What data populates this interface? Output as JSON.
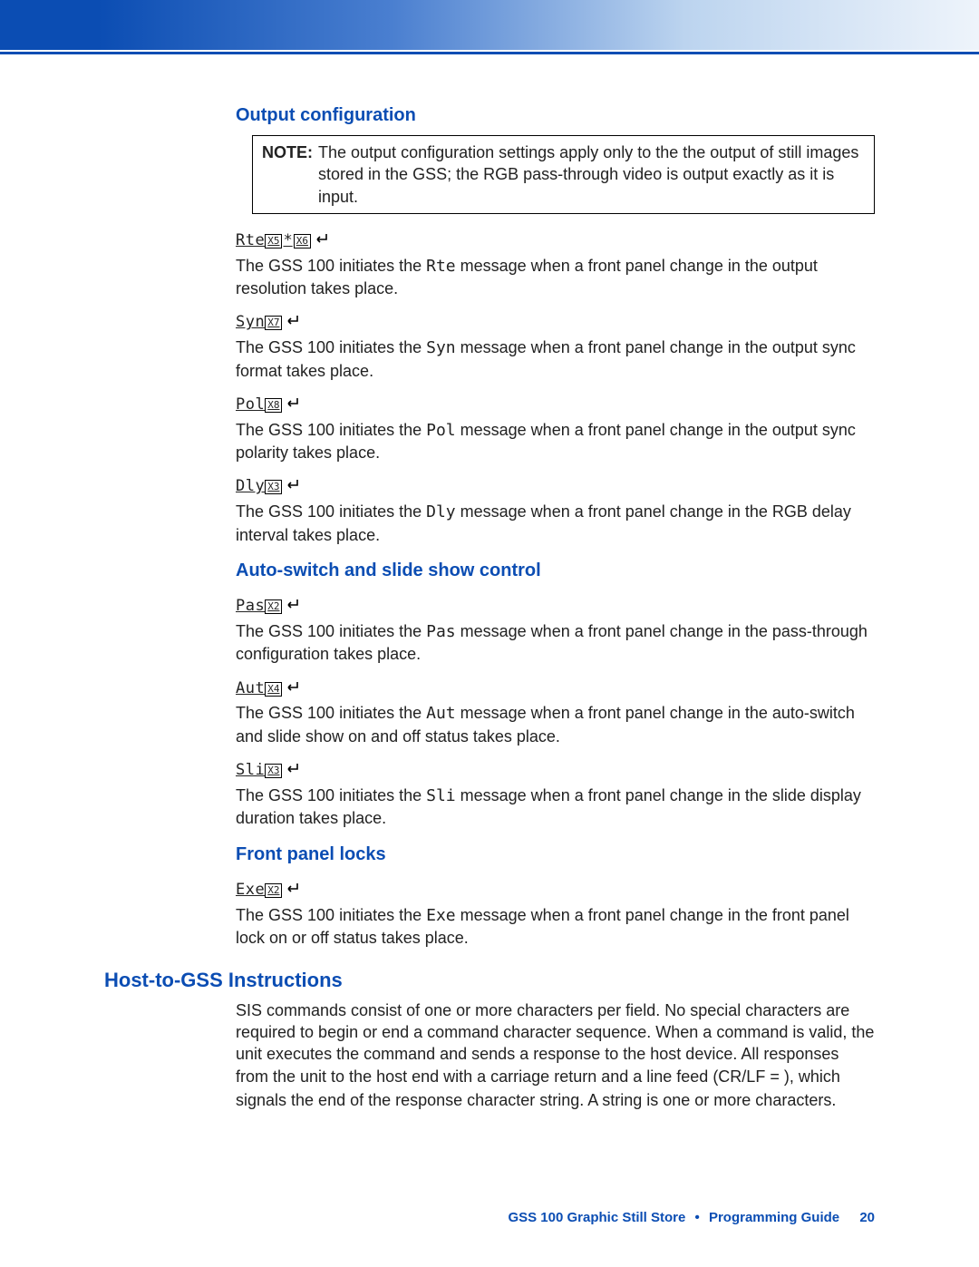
{
  "sections": {
    "output_config": {
      "heading": "Output configuration",
      "note_label": "NOTE:",
      "note_body": "The output configuration settings apply only to the the output of still images stored in the GSS; the RGB pass-through video is output exactly as it is input.",
      "items": [
        {
          "cmd": "Rte",
          "params": [
            "X5",
            "X6"
          ],
          "joiner": "*",
          "part1": "The GSS 100 initiates the ",
          "code": "Rte",
          "part2": " message when a front panel change in the output resolution takes place."
        },
        {
          "cmd": "Syn",
          "params": [
            "X7"
          ],
          "part1": "The GSS 100 initiates the ",
          "code": "Syn",
          "part2": " message when a front panel change in the output sync format takes place."
        },
        {
          "cmd": "Pol",
          "params": [
            "X8"
          ],
          "part1": "The GSS 100 initiates the ",
          "code": "Pol",
          "part2": " message when a front panel change in the output sync polarity takes place."
        },
        {
          "cmd": "Dly",
          "params": [
            "X3"
          ],
          "part1": "The GSS 100 initiates the ",
          "code": "Dly",
          "part2": " message when a front panel change in the RGB delay interval takes place."
        }
      ]
    },
    "auto_switch": {
      "heading": "Auto-switch and slide show control",
      "items": [
        {
          "cmd": "Pas",
          "params": [
            "X2"
          ],
          "part1": "The GSS 100 initiates the ",
          "code": "Pas",
          "part2": " message when a front panel change in the pass-through configuration takes place."
        },
        {
          "cmd": "Aut",
          "params": [
            "X4"
          ],
          "part1": "The GSS 100 initiates the ",
          "code": "Aut",
          "part2": " message when a front panel change in the auto-switch and slide show on and off status takes place."
        },
        {
          "cmd": "Sli",
          "params": [
            "X3"
          ],
          "part1": "The GSS 100 initiates the ",
          "code": "Sli",
          "part2": " message when a front panel change in the slide display duration takes place."
        }
      ]
    },
    "front_panel": {
      "heading": "Front panel locks",
      "items": [
        {
          "cmd": "Exe",
          "params": [
            "X2"
          ],
          "part1": "The GSS 100 initiates the ",
          "code": "Exe",
          "part2": " message when a front panel change in the front panel lock on or off status takes place."
        }
      ]
    },
    "host_to_gss": {
      "heading": "Host-to-GSS Instructions",
      "para_a": "SIS commands consist of one or more characters per field. No special characters are required to begin or end a command character sequence. When a command is valid, the unit executes the command and sends a response to the host device. All responses from the unit to the host end with a carriage return and a line feed (CR/LF = ",
      "para_b": "), which signals the end of the response character string. A string is one or more characters."
    }
  },
  "footer": {
    "doc": "GSS 100 Graphic Still Store",
    "section": "Programming Guide",
    "page": "20"
  }
}
